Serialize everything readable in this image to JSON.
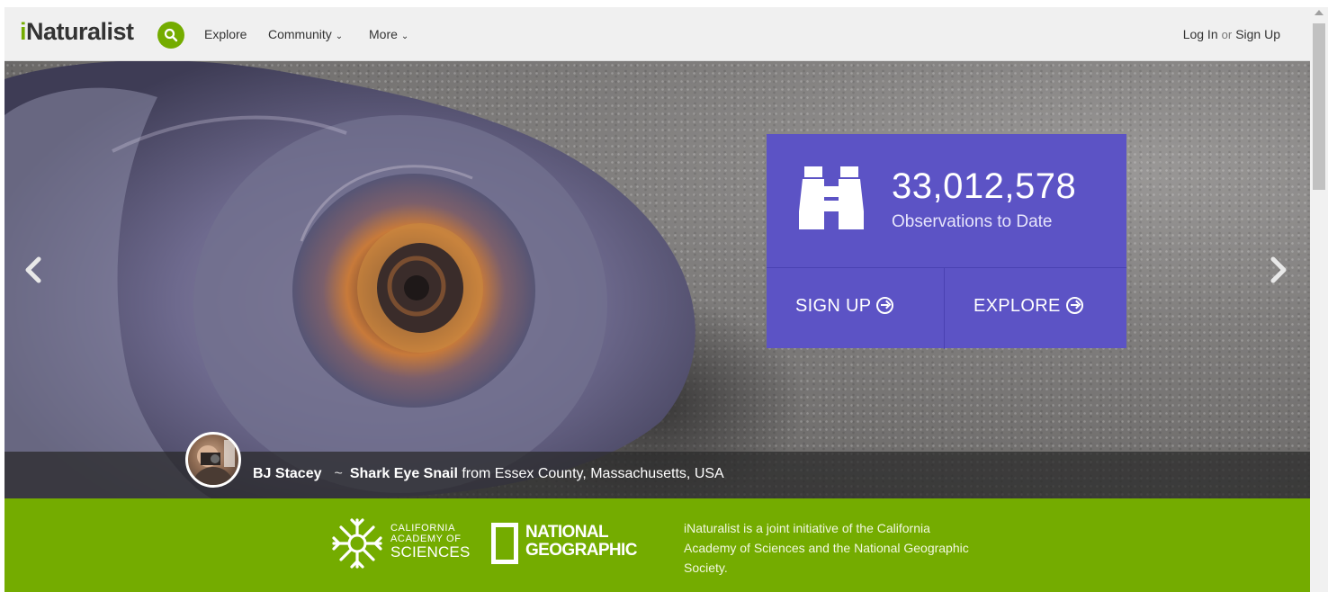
{
  "header": {
    "logo_i": "i",
    "logo_rest": "Naturalist",
    "nav": {
      "explore": "Explore",
      "community": "Community",
      "more": "More"
    },
    "login": "Log In",
    "or": "or",
    "signup": "Sign Up"
  },
  "hero": {
    "observation_count": "33,012,578",
    "observation_label": "Observations to Date",
    "signup_label": "SIGN UP",
    "explore_label": "EXPLORE",
    "caption": {
      "user": "BJ Stacey",
      "separator": "~",
      "taxon": "Shark Eye Snail",
      "location": "from Essex County, Massachusetts, USA"
    }
  },
  "partners": {
    "cas_line1": "CALIFORNIA",
    "cas_line2": "ACADEMY OF",
    "cas_line3": "SCIENCES",
    "natgeo_line1": "NATIONAL",
    "natgeo_line2": "GEOGRAPHIC",
    "initiative_text": "iNaturalist is a joint initiative of the California Academy of Sciences and the National Geographic Society."
  },
  "colors": {
    "brand_green": "#74ac00",
    "panel_purple": "#5c53c5"
  },
  "icons": [
    "search-icon",
    "chevron-down-icon",
    "binoculars-icon",
    "circle-arrow-icon",
    "chevron-left-icon",
    "chevron-right-icon"
  ]
}
